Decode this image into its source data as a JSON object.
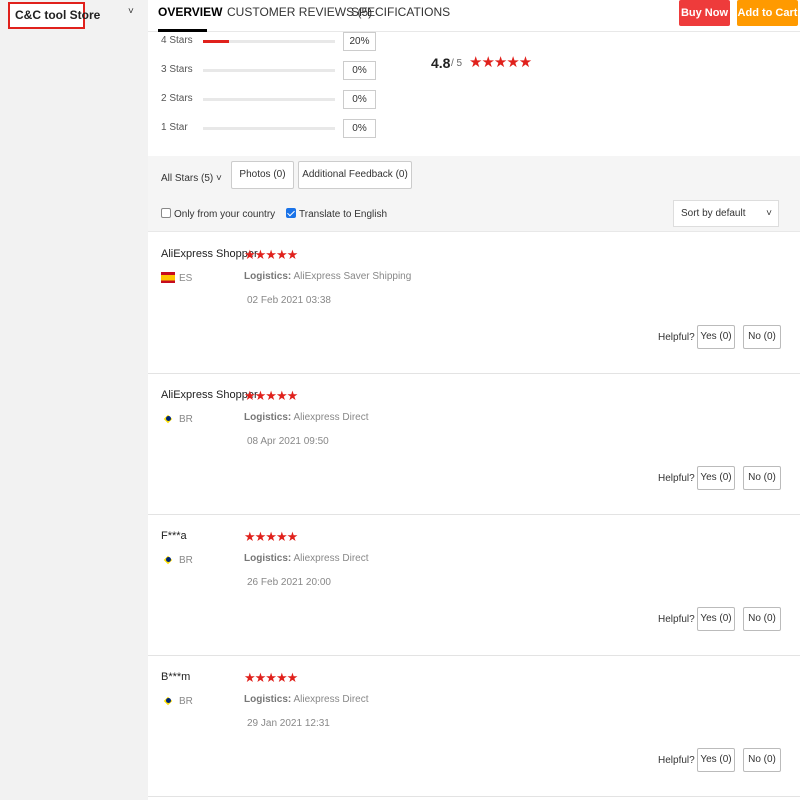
{
  "store": {
    "name": "C&C tool Store",
    "caret": "˅"
  },
  "tabs": [
    {
      "label": "OVERVIEW"
    },
    {
      "label": "CUSTOMER REVIEWS (5)"
    },
    {
      "label": "SPECIFICATIONS"
    }
  ],
  "actions": {
    "buy_now": "Buy Now",
    "add_to_cart": "Add to Cart"
  },
  "ratings": [
    {
      "label": "4 Stars",
      "percent": "20%",
      "fill": 0.2
    },
    {
      "label": "3 Stars",
      "percent": "0%",
      "fill": 0
    },
    {
      "label": "2 Stars",
      "percent": "0%",
      "fill": 0
    },
    {
      "label": "1 Star",
      "percent": "0%",
      "fill": 0
    }
  ],
  "summary": {
    "score": "4.8",
    "max": "/ 5",
    "stars": "★★★★★"
  },
  "filters": {
    "all_stars": "All Stars (5)",
    "all_stars_caret": "˅",
    "photos": "Photos (0)",
    "additional_feedback": "Additional Feedback (0)",
    "only_country": "Only from your country",
    "only_country_checked": false,
    "translate": "Translate to English",
    "translate_checked": true,
    "sort": "Sort by default",
    "sort_caret": "˅"
  },
  "reviews": [
    {
      "name": "AliExpress Shopper",
      "stars": "★★★★★",
      "country": "ES",
      "flag": "flag-spain-icon",
      "logistics_label": "Logistics:",
      "logistics": "AliExpress Saver Shipping",
      "date": "02 Feb 2021 03:38",
      "helpful": "Helpful?",
      "yes": "Yes (0)",
      "no": "No (0)"
    },
    {
      "name": "AliExpress Shopper",
      "stars": "★★★★★",
      "country": "BR",
      "flag": "flag-brazil-icon",
      "logistics_label": "Logistics:",
      "logistics": "Aliexpress Direct",
      "date": "08 Apr 2021 09:50",
      "helpful": "Helpful?",
      "yes": "Yes (0)",
      "no": "No (0)"
    },
    {
      "name": "F***a",
      "stars": "★★★★★",
      "country": "BR",
      "flag": "flag-brazil-icon",
      "logistics_label": "Logistics:",
      "logistics": "Aliexpress Direct",
      "date": "26 Feb 2021 20:00",
      "helpful": "Helpful?",
      "yes": "Yes (0)",
      "no": "No (0)"
    },
    {
      "name": "B***m",
      "stars": "★★★★★",
      "country": "BR",
      "flag": "flag-brazil-icon",
      "logistics_label": "Logistics:",
      "logistics": "Aliexpress Direct",
      "date": "29 Jan 2021 12:31",
      "helpful": "Helpful?",
      "yes": "Yes (0)",
      "no": "No (0)"
    }
  ],
  "colors": {
    "accent_red": "#e0211c",
    "buy_now": "#ee3b3b",
    "add_to_cart": "#ff9a00",
    "checkbox": "#1a73e8"
  }
}
